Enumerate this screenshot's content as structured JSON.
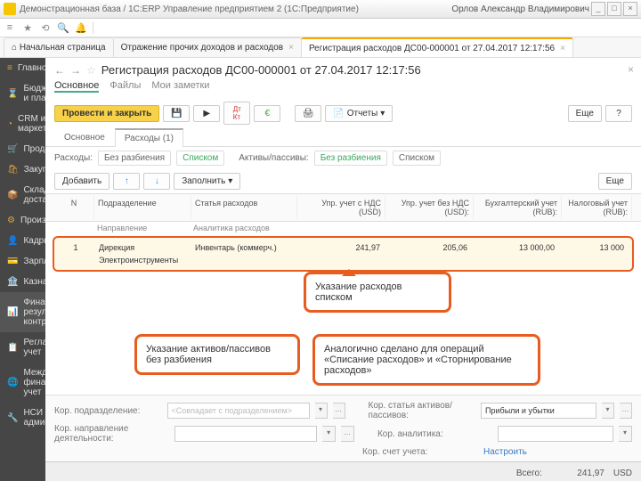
{
  "titlebar": {
    "app": "Демонстрационная база / 1С:ERP Управление предприятием 2  (1С:Предприятие)",
    "user": "Орлов Александр Владимирович"
  },
  "tabs": {
    "home": "Начальная страница",
    "t1": "Отражение прочих доходов и расходов",
    "t2": "Регистрация расходов ДС00-000001 от 27.04.2017 12:17:56"
  },
  "sidebar": {
    "items": [
      {
        "ico": "≡",
        "label": "Главное"
      },
      {
        "ico": "⌛",
        "label": "Бюджетирование и планирование"
      },
      {
        "ico": "◔",
        "label": "CRM и маркетинг"
      },
      {
        "ico": "🛒",
        "label": "Продажи"
      },
      {
        "ico": "🛍",
        "label": "Закупки"
      },
      {
        "ico": "📦",
        "label": "Склад и доставка"
      },
      {
        "ico": "⚙",
        "label": "Производство"
      },
      {
        "ico": "👤",
        "label": "Кадры"
      },
      {
        "ico": "💳",
        "label": "Зарплата"
      },
      {
        "ico": "🏦",
        "label": "Казначейство"
      },
      {
        "ico": "📊",
        "label": "Финансовый результат и контроллинг"
      },
      {
        "ico": "📋",
        "label": "Регламентированный учет"
      },
      {
        "ico": "🌐",
        "label": "Международный финансовый учет"
      },
      {
        "ico": "🔧",
        "label": "НСИ и администрирование"
      }
    ]
  },
  "page": {
    "title": "Регистрация расходов ДС00-000001 от 27.04.2017 12:17:56",
    "subnav": {
      "main": "Основное",
      "files": "Файлы",
      "notes": "Мои заметки"
    },
    "toolbar": {
      "post_close": "Провести и закрыть",
      "reports": "Отчеты",
      "more": "Еще"
    },
    "tabs2": {
      "main": "Основное",
      "exp": "Расходы (1)"
    },
    "filter": {
      "label": "Расходы:",
      "opt1": "Без разбиения",
      "opt2": "Списком",
      "sep": "Активы/пассивы:",
      "opt3": "Без разбиения",
      "opt4": "Списком"
    },
    "tbltb": {
      "add": "Добавить",
      "fill": "Заполнить",
      "more": "Еще"
    },
    "cols": {
      "n": "N",
      "pod": "Подразделение",
      "nap": "Направление",
      "st": "Статья расходов",
      "an": "Аналитика расходов",
      "v1": "Упр. учет с НДС (USD)",
      "v2": "Упр. учет без НДС (USD):",
      "v3": "Бухгалтерский учет (RUB):",
      "v4": "Налоговый учет (RUB):"
    },
    "row": {
      "n": "1",
      "pod": "Дирекция",
      "nap": "Электроинструменты",
      "st": "Инвентарь (коммерч.)",
      "v1": "241,97",
      "v2": "205,06",
      "v3": "13 000,00",
      "v4": "13 000"
    },
    "annot": {
      "a1": "Указание расходов списком",
      "a2": "Указание активов/пассивов без разбиения",
      "a3": "Аналогично сделано для операций «Списание расходов» и «Сторнирование расходов»"
    },
    "bottom": {
      "l1": "Кор. подразделение:",
      "ph1": "<Совпадает с подразделением>",
      "l2": "Кор. направление деятельности:",
      "l3": "Кор. статья активов/пассивов:",
      "v3": "Прибыли и убытки",
      "l4": "Кор. аналитика:",
      "l5": "Кор. счет учета:",
      "link": "Настроить"
    },
    "status": {
      "total_lbl": "Всего:",
      "total": "241,97",
      "cur": "USD"
    }
  }
}
